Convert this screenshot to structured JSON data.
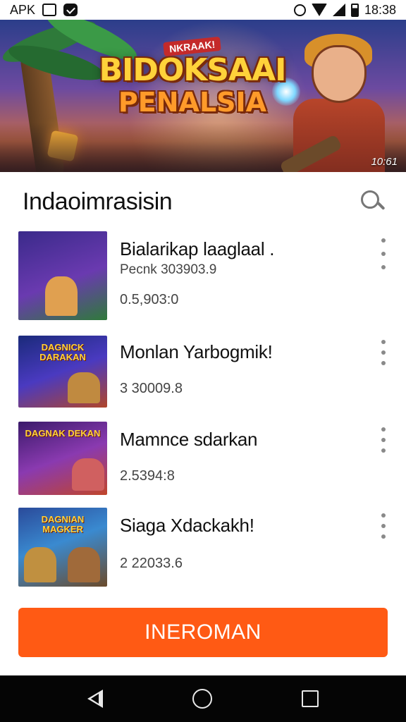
{
  "status_bar": {
    "carrier": "APK",
    "time": "18:38",
    "icons": [
      "image-icon",
      "message-icon",
      "alarm-icon",
      "wifi-icon",
      "signal-icon",
      "battery-icon"
    ]
  },
  "hero": {
    "tag": "NKRAAK!",
    "title": "BIDOKSAAI",
    "subtitle": "PENALSIA",
    "badge": "10:61"
  },
  "list_header": {
    "title": "Indaoimrasisin",
    "search_icon": "search-icon"
  },
  "games": [
    {
      "title": "Bialarikap laaglaal .",
      "subtitle": "Pecnk 303903.9",
      "meta": "0.5,903:0",
      "thumb_label": "",
      "colors": [
        "#3a2a8a",
        "#6a3ab0",
        "#2f7a3a"
      ]
    },
    {
      "title": "Monlan Yarbogmik!",
      "subtitle": "",
      "meta": "3 30009.8",
      "thumb_label": "DAGNICK DARAKAN",
      "colors": [
        "#1a2a7a",
        "#4a3ac0",
        "#b0452a"
      ]
    },
    {
      "title": "Mamnce sdarkan",
      "subtitle": "",
      "meta": "2.5394:8",
      "thumb_label": "DAGNAK DEKAN",
      "colors": [
        "#3a1a6a",
        "#8a3ab0",
        "#c0452a"
      ]
    },
    {
      "title": "Siaga Xdackakh!",
      "subtitle": "",
      "meta": "2 22033.6",
      "thumb_label": "DAGNIAN MAGKER",
      "colors": [
        "#2a4a9a",
        "#3a8ad0",
        "#6a4a2a"
      ]
    }
  ],
  "cta": {
    "label": "INEROMAN",
    "color": "#ff5a14"
  },
  "nav_bar": {
    "icons": [
      "back-icon",
      "home-icon",
      "recents-icon"
    ]
  }
}
